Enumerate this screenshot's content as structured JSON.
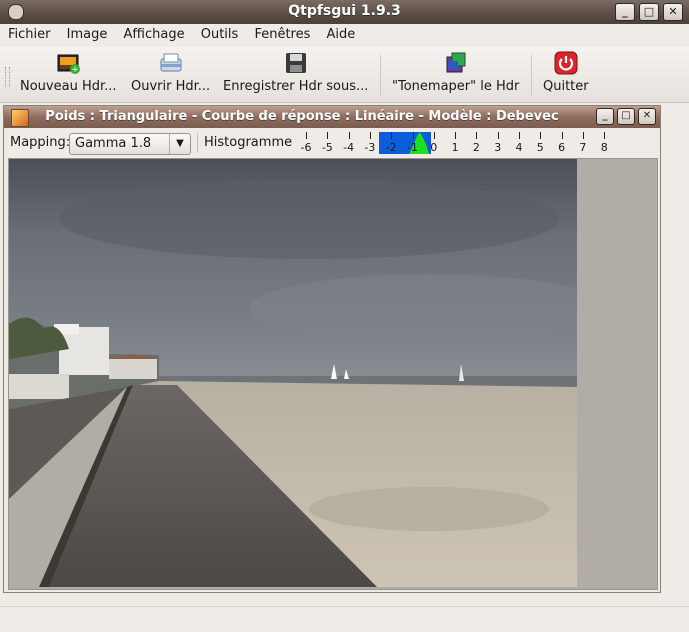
{
  "app": {
    "title": "Qtpfsgui 1.9.3"
  },
  "menu": [
    {
      "label": "Fichier"
    },
    {
      "label": "Image"
    },
    {
      "label": "Affichage"
    },
    {
      "label": "Outils"
    },
    {
      "label": "Fenêtres"
    },
    {
      "label": "Aide"
    }
  ],
  "toolbar": {
    "new_label": "Nouveau Hdr...",
    "open_label": "Ouvrir Hdr...",
    "save_label": "Enregistrer Hdr sous...",
    "tonemap_label": "\"Tonemaper\" le Hdr",
    "quit_label": "Quitter"
  },
  "subwindow": {
    "title": "Poids : Triangulaire - Courbe de réponse : Linéaire - Modèle : Debevec"
  },
  "mapping": {
    "label": "Mapping:",
    "selected": "Gamma 1.8"
  },
  "histogram": {
    "label": "Histogramme",
    "ticks": [
      "-6",
      "-5",
      "-4",
      "-3",
      "-2",
      "-1",
      "0",
      "1",
      "2",
      "3",
      "4",
      "5",
      "6",
      "7",
      "8"
    ],
    "selection_range": [
      "-2",
      "0"
    ]
  },
  "colors": {
    "accent": "#0b5ed9",
    "histogram_fill": "#1fe01f",
    "title_bar": "#5e5147"
  }
}
